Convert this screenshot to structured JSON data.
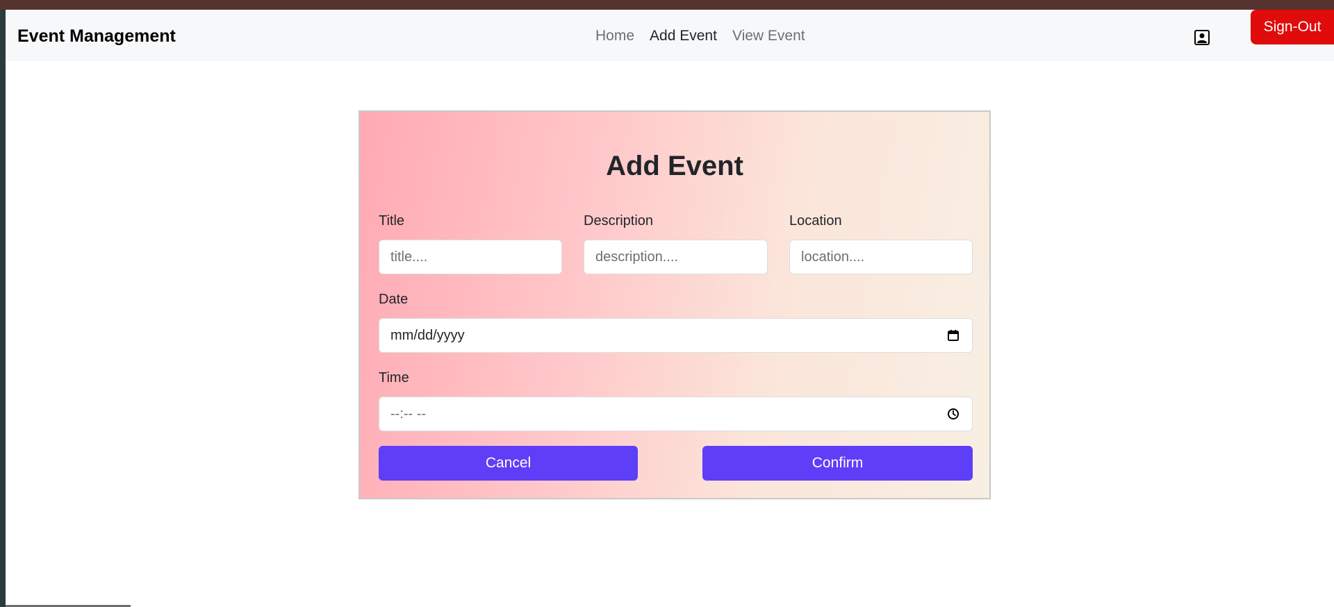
{
  "nav": {
    "brand": "Event Management",
    "links": [
      "Home",
      "Add Event",
      "View Event"
    ],
    "active_link": "Add Event",
    "profile_icon": "person-badge-icon",
    "signout_label": "Sign-Out"
  },
  "form": {
    "title": "Add Event",
    "fields": {
      "title": {
        "label": "Title",
        "placeholder": "title...."
      },
      "description": {
        "label": "Description",
        "placeholder": "description...."
      },
      "location": {
        "label": "Location",
        "placeholder": "location...."
      },
      "date": {
        "label": "Date",
        "value": "mm/dd/yyyy",
        "icon": "calendar-icon"
      },
      "time": {
        "label": "Time",
        "value": "--:-- --",
        "icon": "clock-icon"
      }
    },
    "cancel_label": "Cancel",
    "confirm_label": "Confirm"
  },
  "colors": {
    "signout": "#e00b0b",
    "button": "#5e3ef7",
    "topbar": "#56322e"
  }
}
